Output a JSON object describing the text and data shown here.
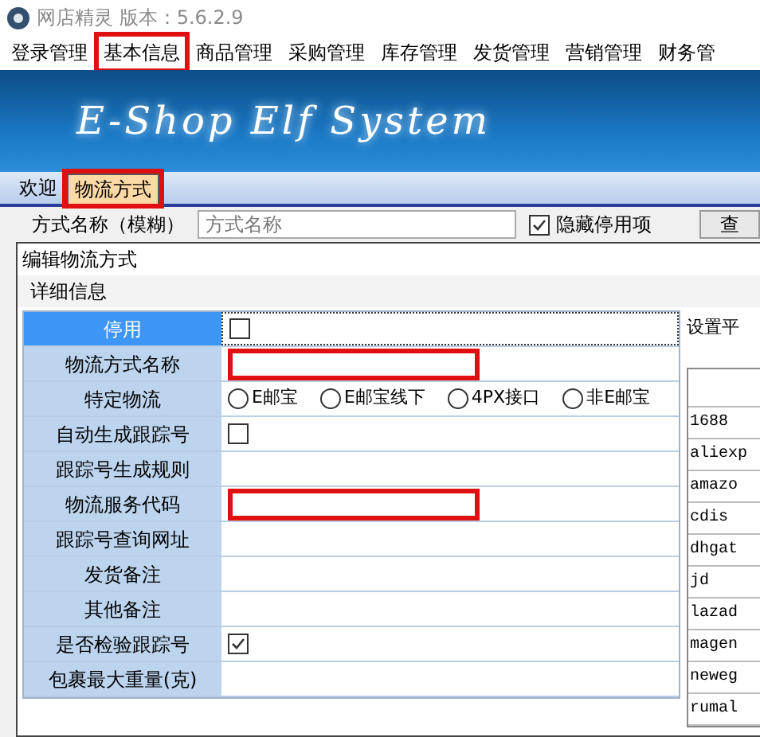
{
  "window": {
    "title": "网店精灵  版本：5.6.2.9"
  },
  "menu": [
    {
      "label": "登录管理",
      "highlighted": false
    },
    {
      "label": "基本信息",
      "highlighted": true
    },
    {
      "label": "商品管理",
      "highlighted": false
    },
    {
      "label": "采购管理",
      "highlighted": false
    },
    {
      "label": "库存管理",
      "highlighted": false
    },
    {
      "label": "发货管理",
      "highlighted": false
    },
    {
      "label": "营销管理",
      "highlighted": false
    },
    {
      "label": "财务管",
      "highlighted": false
    }
  ],
  "banner": {
    "logo_text": "E-Shop Elf System"
  },
  "tabs": [
    {
      "label": "欢迎",
      "selected": false,
      "highlighted": false
    },
    {
      "label": "物流方式",
      "selected": true,
      "highlighted": true
    }
  ],
  "search": {
    "label": "方式名称（模糊）",
    "placeholder": "方式名称",
    "hide_disabled": {
      "label": "隐藏停用项",
      "checked": true
    },
    "button": "查"
  },
  "dialog": {
    "title": "编辑物流方式",
    "group": "详细信息",
    "rows": [
      {
        "label": "停用",
        "kind": "checkbox",
        "checked": false,
        "selected": true
      },
      {
        "label": "物流方式名称",
        "kind": "text",
        "selected": false,
        "highlighted": true
      },
      {
        "label": "特定物流",
        "kind": "radio",
        "selected": false,
        "options": [
          {
            "label": "E邮宝",
            "selected": false
          },
          {
            "label": "E邮宝线下",
            "selected": false
          },
          {
            "label": "4PX接口",
            "selected": false
          },
          {
            "label": "非E邮宝",
            "selected": false
          }
        ]
      },
      {
        "label": "自动生成跟踪号",
        "kind": "checkbox",
        "checked": false,
        "selected": false
      },
      {
        "label": "跟踪号生成规则",
        "kind": "text",
        "selected": false,
        "highlighted": false
      },
      {
        "label": "物流服务代码",
        "kind": "text",
        "selected": false,
        "highlighted": true
      },
      {
        "label": "跟踪号查询网址",
        "kind": "text",
        "selected": false,
        "highlighted": false
      },
      {
        "label": "发货备注",
        "kind": "text",
        "selected": false,
        "highlighted": false
      },
      {
        "label": "其他备注",
        "kind": "text",
        "selected": false,
        "highlighted": false
      },
      {
        "label": "是否检验跟踪号",
        "kind": "checkbox",
        "checked": true,
        "selected": false
      },
      {
        "label": "包裹最大重量(克)",
        "kind": "text",
        "selected": false,
        "highlighted": false
      }
    ],
    "side_panel": {
      "title": "设置平",
      "platforms": [
        "1688",
        "aliexp",
        "amazo",
        "cdis",
        "dhgat",
        "jd",
        "lazad",
        "magen",
        "neweg",
        "rumal"
      ]
    }
  }
}
